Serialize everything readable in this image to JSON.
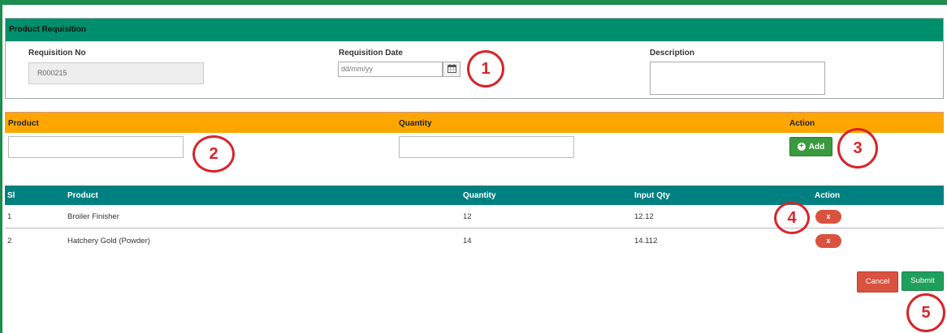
{
  "requisition": {
    "title": "Product Requisition",
    "no_label": "Requisition No",
    "no_value": "R000215",
    "date_label": "Requisition Date",
    "date_placeholder": "dd/mm/yy",
    "description_label": "Description",
    "description_value": ""
  },
  "entry": {
    "product_label": "Product",
    "quantity_label": "Quantity",
    "action_label": "Action",
    "product_value": "",
    "quantity_value": "",
    "add_label": "Add"
  },
  "table": {
    "headers": [
      "Sl",
      "Product",
      "Quantity",
      "Input Qty",
      "Action"
    ],
    "rows": [
      {
        "sl": "1",
        "product": "Broiler Finisher",
        "quantity": "12",
        "input_qty": "12.12",
        "action": "x"
      },
      {
        "sl": "2",
        "product": "Hatchery Gold (Powder)",
        "quantity": "14",
        "input_qty": "14.112",
        "action": "x"
      }
    ]
  },
  "footer": {
    "cancel_label": "Cancel",
    "submit_label": "Submit"
  },
  "callouts": [
    "1",
    "2",
    "3",
    "4",
    "5"
  ],
  "icons": {
    "calendar": "calendar-icon",
    "add": "plus-circle-icon",
    "resize": "resize-grip-icon"
  },
  "colors": {
    "panel_header": "#008f6c",
    "entry_header": "#fda600",
    "table_header": "#008080",
    "add_button": "#3a9a3e",
    "delete_button": "#d9523f",
    "submit_button": "#1fa05a",
    "callout": "#d7242a"
  }
}
